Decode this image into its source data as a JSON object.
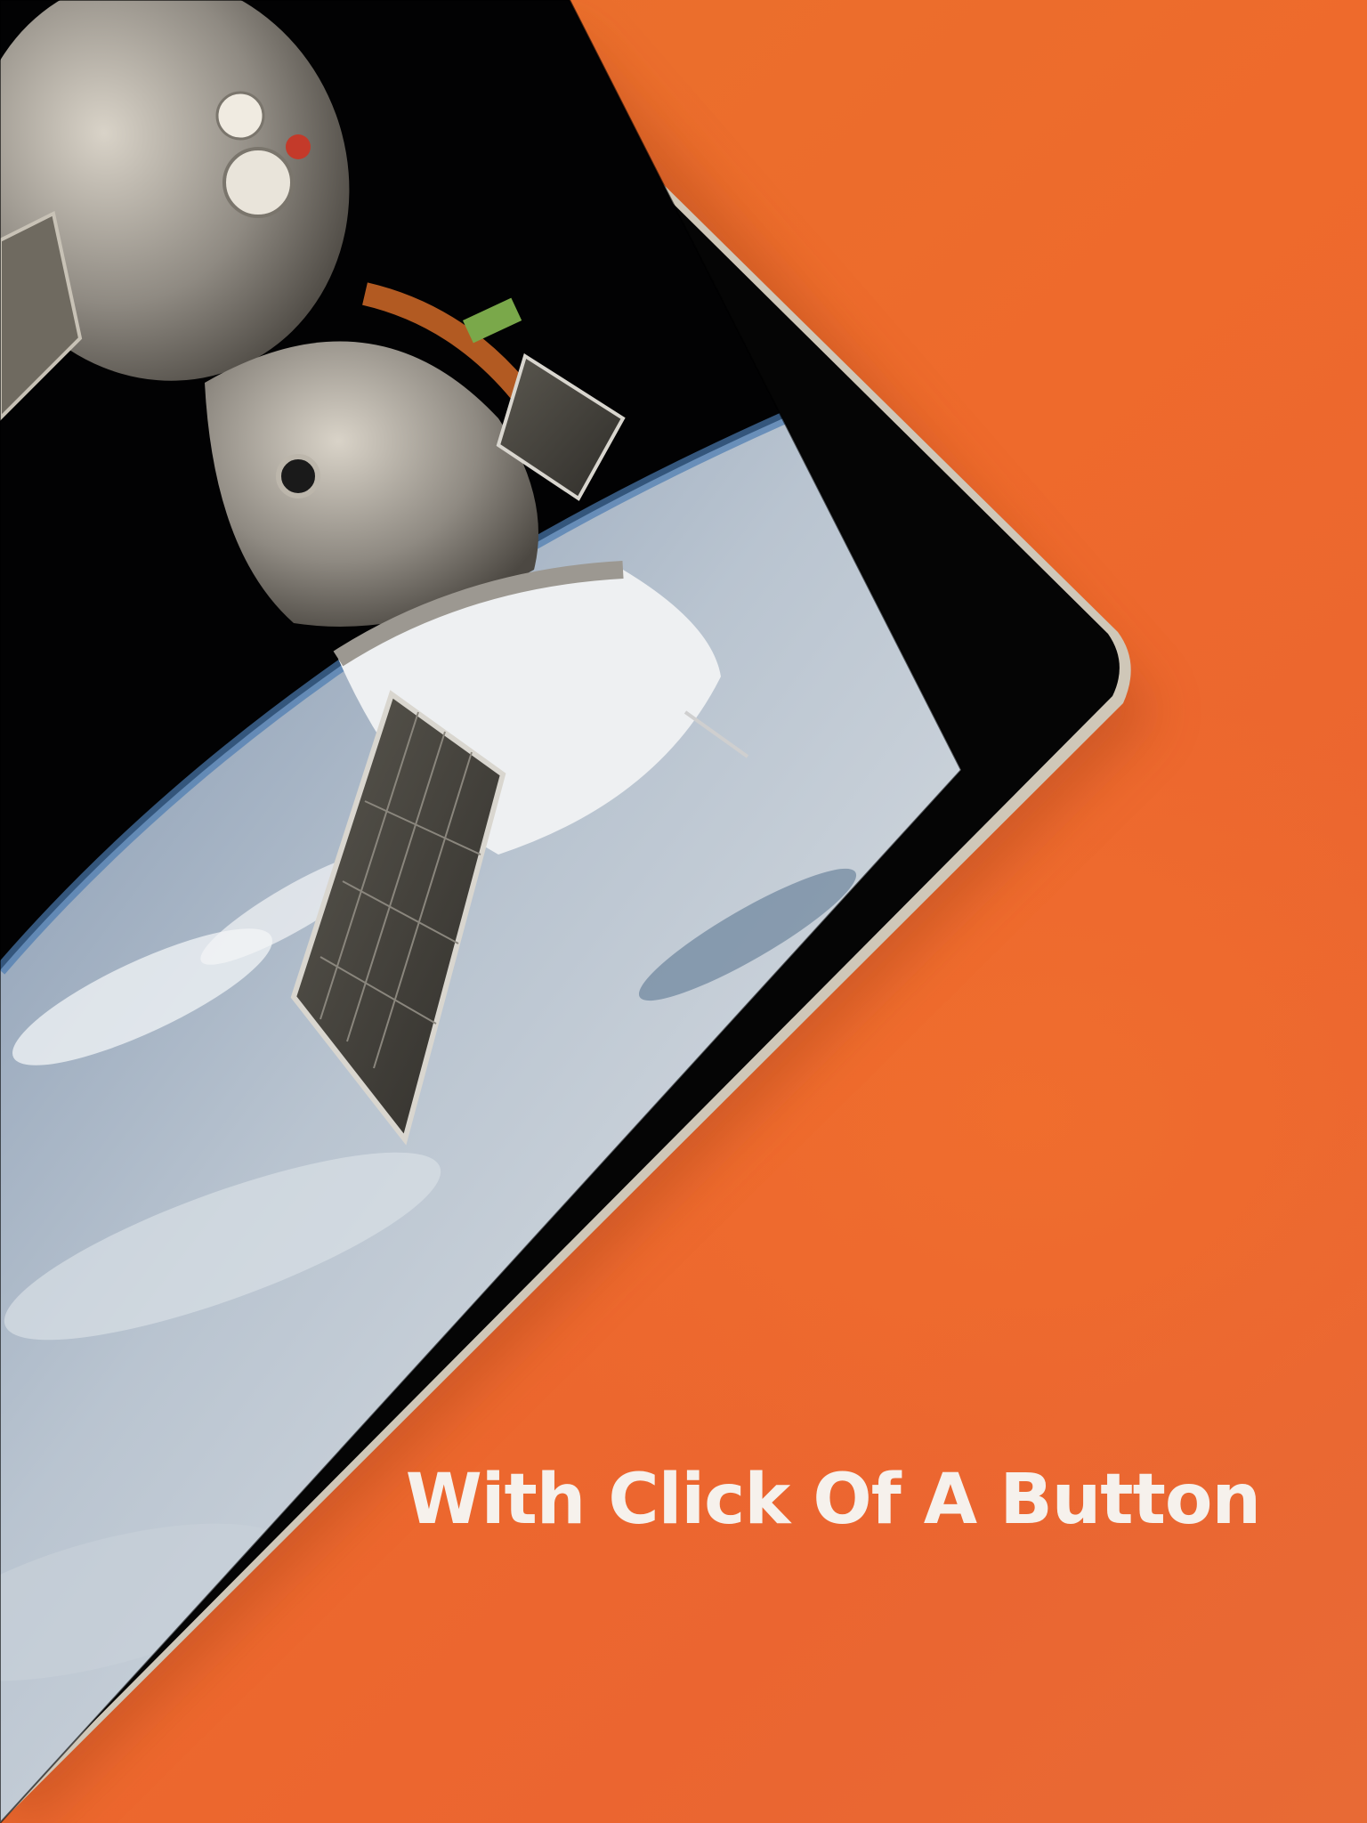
{
  "colors": {
    "background": "#ea6a2c",
    "device_bezel": "#050505",
    "device_frame": "#cfc7b8",
    "caption_text": "#f6f1ec"
  },
  "caption": {
    "text": "With Click Of A Button"
  },
  "screen_content": {
    "subject": "spacecraft-photo"
  }
}
